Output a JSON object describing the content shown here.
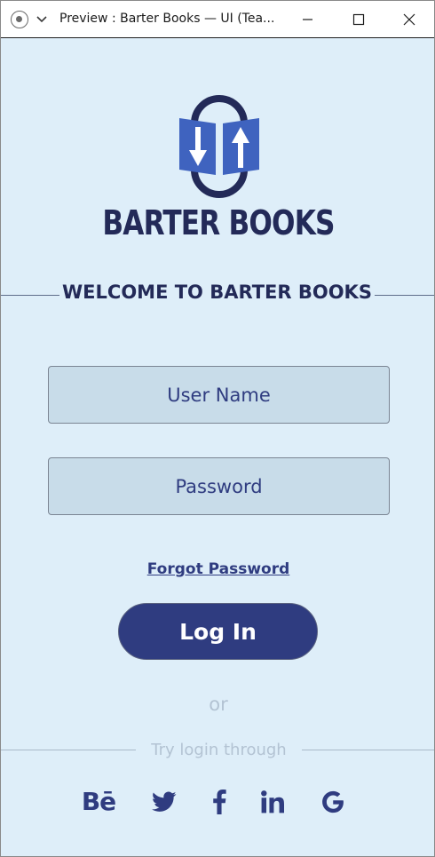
{
  "window": {
    "title": "Preview : Barter Books — UI (Tea..."
  },
  "logo": {
    "text": "BARTER BOOKS"
  },
  "welcome": {
    "heading": "WELCOME TO BARTER BOOKS"
  },
  "form": {
    "username_placeholder": "User Name",
    "password_placeholder": "Password",
    "forgot_label": "Forgot Password",
    "login_label": "Log In",
    "or_label": "or",
    "try_label": "Try login through"
  },
  "social": [
    {
      "name": "behance-icon",
      "label": "Bē"
    },
    {
      "name": "twitter-icon"
    },
    {
      "name": "facebook-icon"
    },
    {
      "name": "linkedin-icon"
    },
    {
      "name": "google-icon"
    }
  ],
  "colors": {
    "background": "#deeef9",
    "primary": "#2f3c80",
    "dark_text": "#232a58",
    "input_fill": "#c8dce9",
    "muted": "#b3c3d3"
  }
}
